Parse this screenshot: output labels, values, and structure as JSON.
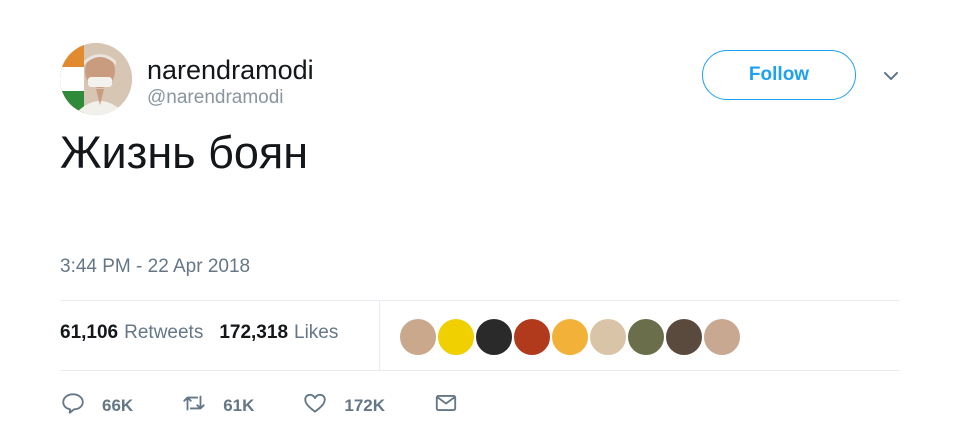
{
  "user": {
    "name": "narendramodi",
    "handle": "@narendramodi",
    "follow_label": "Follow"
  },
  "tweet": {
    "text": "Жизнь боян",
    "timestamp": "3:44 PM - 22 Apr 2018"
  },
  "stats": {
    "retweets_value": "61,106",
    "retweets_label": "Retweets",
    "likes_value": "172,318",
    "likes_label": "Likes"
  },
  "liker_avatars": [
    {
      "color": "#c9a88c"
    },
    {
      "color": "#f0d000"
    },
    {
      "color": "#2a2a2a"
    },
    {
      "color": "#b13a1c"
    },
    {
      "color": "#f2b23a"
    },
    {
      "color": "#d9c4a8"
    },
    {
      "color": "#6b6e4a"
    },
    {
      "color": "#5a4a3e"
    },
    {
      "color": "#c8a890"
    }
  ],
  "actions": {
    "replies": "66K",
    "retweets": "61K",
    "likes": "172K"
  },
  "colors": {
    "accent": "#1da1f2",
    "text": "#14171a",
    "muted": "#657786",
    "divider": "#e6ecf0"
  }
}
